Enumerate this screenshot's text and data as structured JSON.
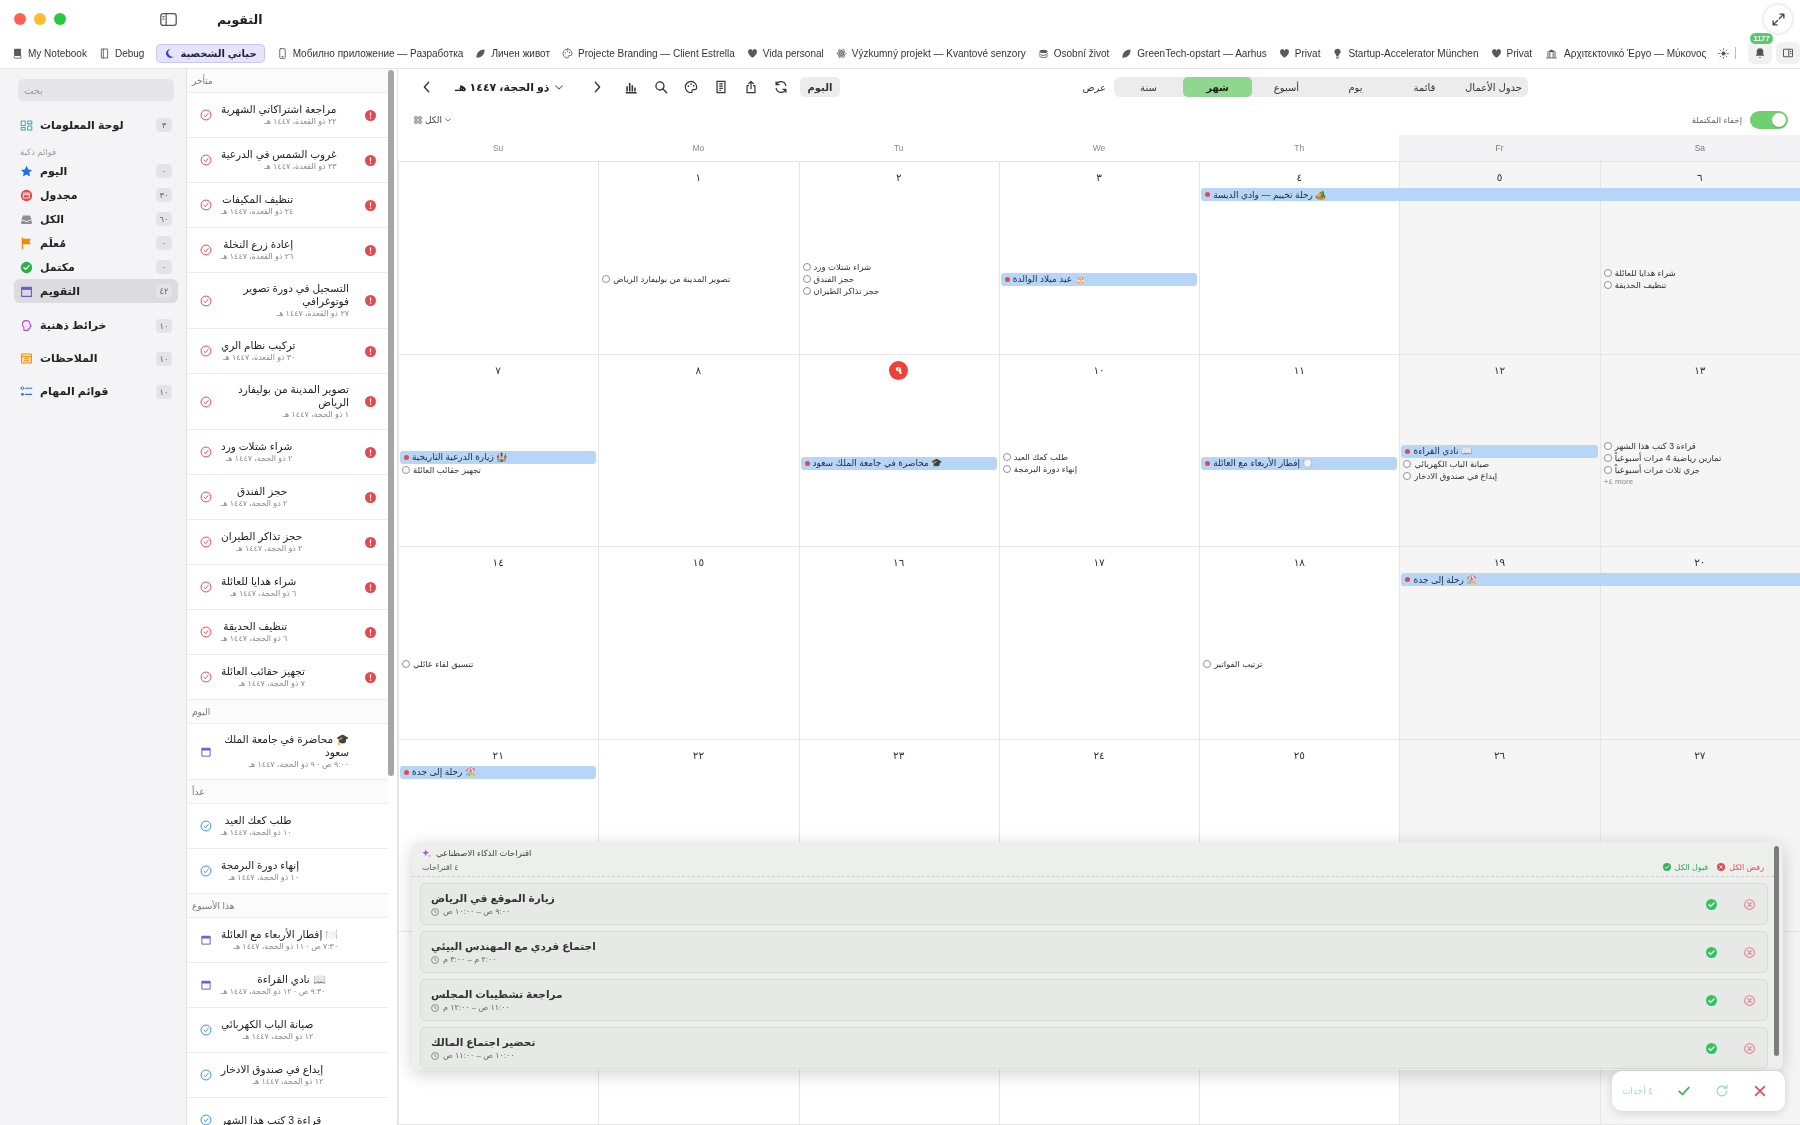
{
  "window": {
    "title": "التقويم"
  },
  "tabs": [
    {
      "selected": false
    },
    {
      "label": "Αρχιτεκτονικό Έργο — Μύκονος",
      "selected": false
    },
    {
      "label": "Privat",
      "selected": false
    },
    {
      "label": "Startup-Accelerator München",
      "selected": false
    },
    {
      "label": "Privat",
      "selected": false
    },
    {
      "label": "GreenTech-opstart — Aarhus",
      "selected": false
    },
    {
      "label": "Osobní život",
      "selected": false
    },
    {
      "label": "Výzkumný projekt — Kvantové senzory",
      "selected": false
    },
    {
      "label": "Vida personal",
      "selected": false
    },
    {
      "label": "Projecte Branding — Client Estrella",
      "selected": false
    },
    {
      "label": "Личен живот",
      "selected": false
    },
    {
      "label": "Мобилно приложение — Разработка",
      "selected": false
    },
    {
      "label": "حياتي الشخصية",
      "selected": true
    },
    {
      "label": "Debug",
      "selected": false
    },
    {
      "label": "My Notebook",
      "selected": false
    }
  ],
  "notifications": {
    "badge": "1177"
  },
  "sidebar": {
    "search": {
      "placeholder": "بحث"
    },
    "groups": [
      {
        "items": [
          {
            "label": "لوحة المعلومات",
            "count": "٣",
            "selected": false
          }
        ]
      },
      {
        "title": "قوائم ذكية",
        "items": [
          {
            "label": "اليوم",
            "count": "٠",
            "selected": false
          },
          {
            "label": "مجدول",
            "count": "٣٠",
            "selected": false
          },
          {
            "label": "الكل",
            "count": "٦٠",
            "selected": false
          },
          {
            "label": "مُعلَم",
            "count": "٠",
            "selected": false
          },
          {
            "label": "مكتمل",
            "count": "٠",
            "selected": false
          },
          {
            "label": "التقويم",
            "count": "٤٢",
            "selected": true
          }
        ]
      },
      {
        "items": [
          {
            "label": "خرائط ذهنية",
            "count": "١٠",
            "selected": false
          },
          {
            "label": "الملاحظات",
            "count": "١٠",
            "selected": false
          },
          {
            "label": "قوائم المهام",
            "count": "١٠",
            "selected": false
          }
        ]
      }
    ]
  },
  "task_list": {
    "sections": [
      {
        "title": "متأخر",
        "items": [
          {
            "kind": "task",
            "title": "مراجعة اشتراكاتي الشهرية",
            "date": "٢٢ ذو القعدة، ١٤٤٧ هـ",
            "overdue": true
          },
          {
            "kind": "task",
            "title": "غروب الشمس في الدرعية",
            "date": "٢٣ ذو القعدة، ١٤٤٧ هـ",
            "overdue": true
          },
          {
            "kind": "task",
            "title": "تنظيف المكيفات",
            "date": "٢٤ ذو القعدة، ١٤٤٧ هـ",
            "overdue": true
          },
          {
            "kind": "task",
            "title": "إعادة زرع النخلة",
            "date": "٢٦ ذو القعدة، ١٤٤٧ هـ",
            "overdue": true
          },
          {
            "kind": "task",
            "title": "التسجيل في دورة تصوير فوتوغرافي",
            "date": "٢٧ ذو القعدة، ١٤٤٧ هـ",
            "overdue": true
          },
          {
            "kind": "task",
            "title": "تركيب نظام الري",
            "date": "٣٠ ذو القعدة، ١٤٤٧ هـ",
            "overdue": true
          },
          {
            "kind": "task",
            "title": "تصوير المدينة من بوليفارد الرياض",
            "date": "١ ذو الحجة، ١٤٤٧ هـ",
            "overdue": true
          },
          {
            "kind": "task",
            "title": "شراء شتلات ورد",
            "date": "٢ ذو الحجة، ١٤٤٧ هـ",
            "overdue": true
          },
          {
            "kind": "task",
            "title": "حجز الفندق",
            "date": "٢ ذو الحجة، ١٤٤٧ هـ",
            "overdue": true
          },
          {
            "kind": "task",
            "title": "حجز تذاكر الطيران",
            "date": "٢ ذو الحجة، ١٤٤٧ هـ",
            "overdue": true
          },
          {
            "kind": "task",
            "title": "شراء هدايا للعائلة",
            "date": "٦ ذو الحجة، ١٤٤٧ هـ",
            "overdue": true
          },
          {
            "kind": "task",
            "title": "تنظيف الحديقة",
            "date": "٦ ذو الحجة، ١٤٤٧ هـ",
            "overdue": true
          },
          {
            "kind": "task",
            "title": "تجهيز حقائب العائلة",
            "date": "٧ ذو الحجة، ١٤٤٧ هـ",
            "overdue": true
          }
        ]
      },
      {
        "title": "اليوم",
        "items": [
          {
            "kind": "event",
            "title": "🎓 محاضرة في جامعة الملك سعود",
            "date": "٩:٠٠ ص · ٩ ذو الحجة، ١٤٤٧ هـ",
            "overdue": false
          }
        ]
      },
      {
        "title": "غداً",
        "items": [
          {
            "kind": "task",
            "title": "طلب كعك العيد",
            "date": "١٠ ذو الحجة، ١٤٤٧ هـ",
            "overdue": false
          },
          {
            "kind": "task",
            "title": "إنهاء دورة البرمجة",
            "date": "١٠ ذو الحجة، ١٤٤٧ هـ",
            "overdue": false
          }
        ]
      },
      {
        "title": "هذا الأسبوع",
        "items": [
          {
            "kind": "event",
            "title": "🍽️ إفطار الأربعاء مع العائلة",
            "date": "٧:٣٠ ص · ١١ ذو الحجة، ١٤٤٧ هـ",
            "overdue": false
          },
          {
            "kind": "event",
            "title": "📖 نادي القراءة",
            "date": "٩:٣٠ ص · ١٢ ذو الحجة، ١٤٤٧ هـ",
            "overdue": false
          },
          {
            "kind": "task",
            "title": "صيانة الباب الكهربائي",
            "date": "١٢ ذو الحجة، ١٤٤٧ هـ",
            "overdue": false
          },
          {
            "kind": "task",
            "title": "إيداع في صندوق الادخار",
            "date": "١٢ ذو الحجة، ١٤٤٧ هـ",
            "overdue": false
          },
          {
            "kind": "task",
            "title": "قراءة 3 كتب هذا الشهر",
            "overdue": false
          }
        ]
      }
    ]
  },
  "calendar": {
    "toolbar": {
      "title": "ذو الحجة، ١٤٤٧ هـ",
      "today_button": "اليوم",
      "view_label": "عرض",
      "views": [
        {
          "label": "جدول الأعمال",
          "selected": false
        },
        {
          "label": "قائمة",
          "selected": false
        },
        {
          "label": "يوم",
          "selected": false
        },
        {
          "label": "أسبوع",
          "selected": false
        },
        {
          "label": "شهر",
          "selected": true
        },
        {
          "label": "سنة",
          "selected": false
        }
      ]
    },
    "filter": {
      "label": "الكل"
    },
    "hide_completed": {
      "label": "إخفاء المكتملة",
      "on": true
    },
    "weekdays": [
      {
        "label": "Sa",
        "weekend": true
      },
      {
        "label": "Fr",
        "weekend": true
      },
      {
        "label": "Th",
        "weekend": false
      },
      {
        "label": "We",
        "weekend": false
      },
      {
        "label": "Tu",
        "weekend": false
      },
      {
        "label": "Mo",
        "weekend": false
      },
      {
        "label": "Su",
        "weekend": false
      }
    ],
    "weeks": [
      {
        "days": [
          {
            "number": "٦",
            "today": false,
            "items": [
              {
                "kind": "task",
                "title": "شراء هدايا للعائلة",
                "done": false
              },
              {
                "kind": "task",
                "title": "تنظيف الحديقة",
                "done": false
              }
            ]
          },
          {
            "number": "٥",
            "today": false
          },
          {
            "number": "٤",
            "today": false,
            "span": {
              "title": "🏕️ رحلة تخييم — وادي الديسة",
              "to_week_end": true
            }
          },
          {
            "number": "٣",
            "today": false,
            "items": [
              {
                "kind": "event",
                "title": "🎂 عيد ميلاد الوالدة"
              }
            ]
          },
          {
            "number": "٢",
            "today": false,
            "items": [
              {
                "kind": "task",
                "title": "شراء شتلات ورد",
                "done": false
              },
              {
                "kind": "task",
                "title": "حجز الفندق",
                "done": false
              },
              {
                "kind": "task",
                "title": "حجز تذاكر الطيران",
                "done": false
              }
            ]
          },
          {
            "number": "١",
            "today": false,
            "items": [
              {
                "kind": "task",
                "title": "تصوير المدينة من بوليفارد الرياض",
                "done": false
              }
            ]
          }
        ]
      },
      {
        "days": [
          {
            "number": "١٣",
            "today": false,
            "items": [
              {
                "kind": "task",
                "title": "قراءة 3 كتب هذا الشهر",
                "done": false
              },
              {
                "kind": "task",
                "title": "تمارين رياضية 4 مرات أسبوعياً",
                "done": false
              },
              {
                "kind": "task",
                "title": "جري ثلاث مرات أسبوعياً",
                "done": false
              }
            ],
            "more": "+٤ more"
          },
          {
            "number": "١٢",
            "today": false,
            "items": [
              {
                "kind": "event",
                "title": "📖 نادي القراءة"
              },
              {
                "kind": "task",
                "title": "صيانة الباب الكهربائي",
                "done": false
              },
              {
                "kind": "task",
                "title": "إيداع في صندوق الادخار",
                "done": false
              }
            ]
          },
          {
            "number": "١١",
            "today": false,
            "items": [
              {
                "kind": "event",
                "title": "🍽️ إفطار الأربعاء مع العائلة"
              }
            ]
          },
          {
            "number": "١٠",
            "today": false,
            "items": [
              {
                "kind": "task",
                "title": "طلب كعك العيد",
                "done": false
              },
              {
                "kind": "task",
                "title": "إنهاء دورة البرمجة",
                "done": false
              }
            ]
          },
          {
            "number": "٩",
            "today": true,
            "items": [
              {
                "kind": "event",
                "title": "🎓 محاضرة في جامعة الملك سعود"
              }
            ]
          },
          {
            "number": "٨",
            "today": false
          },
          {
            "number": "٧",
            "today": false,
            "items": [
              {
                "kind": "event",
                "title": "🏰 زيارة الدرعية التاريخية"
              },
              {
                "kind": "task",
                "title": "تجهيز حقائب العائلة",
                "done": false
              }
            ]
          }
        ]
      },
      {
        "days": [
          {
            "number": "٢٠",
            "today": false
          },
          {
            "number": "١٩",
            "today": false,
            "span": {
              "title": "🏖️ رحلة إلى جدة",
              "to_week_end": true
            }
          },
          {
            "number": "١٨",
            "today": false,
            "items": [
              {
                "kind": "task",
                "title": "ترتيب الفواتير",
                "done": false
              }
            ]
          },
          {
            "number": "١٧",
            "today": false
          },
          {
            "number": "١٦",
            "today": false
          },
          {
            "number": "١٥",
            "today": false
          },
          {
            "number": "١٤",
            "today": false,
            "items": [
              {
                "kind": "task",
                "title": "تنسيق لقاء عائلي",
                "done": false
              }
            ]
          }
        ]
      },
      {
        "days": [
          {
            "number": "٢٧",
            "today": false
          },
          {
            "number": "٢٦",
            "today": false
          },
          {
            "number": "٢٥",
            "today": false
          },
          {
            "number": "٢٤",
            "today": false
          },
          {
            "number": "٢٣",
            "today": false
          },
          {
            "number": "٢٢",
            "today": false
          },
          {
            "number": "٢١",
            "today": false,
            "span": {
              "title": "🏖️ رحلة إلى جدة",
              "to_week_end": false
            }
          }
        ]
      }
    ]
  },
  "ai_suggestions": {
    "title": "اقتراحات الذكاء الاصطناعي",
    "count": "٤ اقتراحات",
    "accept_all": "قبول الكل",
    "reject_all": "رفض الكل",
    "items": [
      {
        "title": "زيارة الموقع في الرياض",
        "time": "٩:٠٠ ص – ١٠:٠٠ ص"
      },
      {
        "title": "اجتماع فردي مع المهندس البيئي",
        "time": "٢:٠٠ م – ٣:٠٠ م"
      },
      {
        "title": "مراجعة تشطيبات المجلس",
        "time": "١١:٠٠ ص – ١٢:٠٠ م"
      },
      {
        "title": "تحضير اجتماع المالك",
        "time": "١٠:٠٠ ص – ١١:٠٠ ص"
      }
    ]
  },
  "action_bar": {
    "label": "٤ أحداث"
  }
}
